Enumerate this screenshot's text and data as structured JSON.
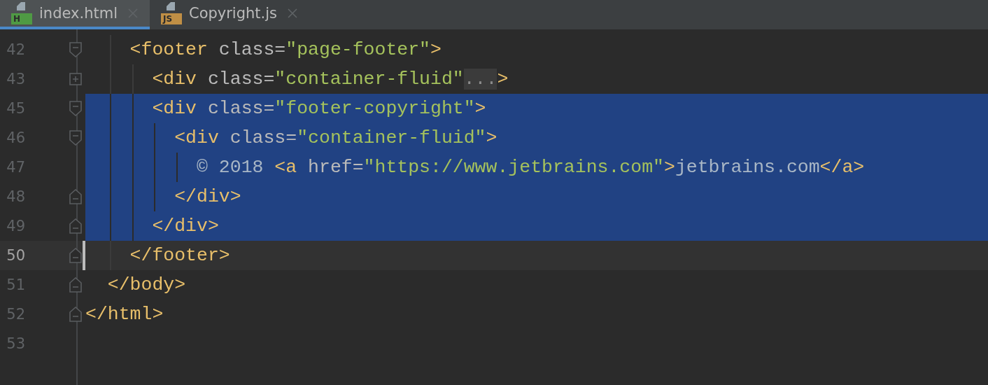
{
  "tabs": [
    {
      "label": "index.html",
      "badge": "H",
      "color": "#4f9a44",
      "selected": true
    },
    {
      "label": "Copyright.js",
      "badge": "JS",
      "color": "#c08f45",
      "selected": false
    }
  ],
  "lines": [
    {
      "number": "42",
      "kind": "opener",
      "selected": false,
      "current": false,
      "tokens": [
        {
          "kind": "tag",
          "text": "    <footer"
        },
        {
          "kind": "attr",
          "text": " class="
        },
        {
          "kind": "string",
          "text": "\"page-footer\""
        },
        {
          "kind": "tag",
          "text": ">"
        }
      ]
    },
    {
      "number": "43",
      "kind": "collapsed",
      "selected": false,
      "current": false,
      "tokens": [
        {
          "kind": "tag",
          "text": "      <div"
        },
        {
          "kind": "attr",
          "text": " class="
        },
        {
          "kind": "string",
          "text": "\"container-fluid\""
        },
        {
          "kind": "folded",
          "text": "..."
        },
        {
          "kind": "tag",
          "text": ">"
        }
      ]
    },
    {
      "number": "45",
      "kind": "opener",
      "selected": true,
      "current": false,
      "tokens": [
        {
          "kind": "tag",
          "text": "      <div"
        },
        {
          "kind": "attr",
          "text": " class="
        },
        {
          "kind": "string",
          "text": "\"footer-copyright\""
        },
        {
          "kind": "tag",
          "text": ">"
        }
      ]
    },
    {
      "number": "46",
      "kind": "opener",
      "selected": true,
      "current": false,
      "tokens": [
        {
          "kind": "tag",
          "text": "        <div"
        },
        {
          "kind": "attr",
          "text": " class="
        },
        {
          "kind": "string",
          "text": "\"container-fluid\""
        },
        {
          "kind": "tag",
          "text": ">"
        }
      ]
    },
    {
      "number": "47",
      "kind": "plain",
      "selected": true,
      "current": false,
      "tokens": [
        {
          "kind": "text",
          "text": "          © 2018 "
        },
        {
          "kind": "tag",
          "text": "<a"
        },
        {
          "kind": "attr",
          "text": " href="
        },
        {
          "kind": "string",
          "text": "\"https://www.jetbrains.com\""
        },
        {
          "kind": "tag",
          "text": ">"
        },
        {
          "kind": "text",
          "text": "jetbrains.com"
        },
        {
          "kind": "tag",
          "text": "</a>"
        }
      ]
    },
    {
      "number": "48",
      "kind": "closer",
      "selected": true,
      "current": false,
      "tokens": [
        {
          "kind": "tag",
          "text": "        </div>"
        }
      ]
    },
    {
      "number": "49",
      "kind": "closer",
      "selected": true,
      "current": false,
      "tokens": [
        {
          "kind": "tag",
          "text": "      </div>"
        }
      ]
    },
    {
      "number": "50",
      "kind": "closer",
      "selected": false,
      "current": true,
      "tokens": [
        {
          "kind": "tag",
          "text": "    </footer>"
        }
      ]
    },
    {
      "number": "51",
      "kind": "closer",
      "selected": false,
      "current": false,
      "tokens": [
        {
          "kind": "tag",
          "text": "  </body>"
        }
      ]
    },
    {
      "number": "52",
      "kind": "closer",
      "selected": false,
      "current": false,
      "tokens": [
        {
          "kind": "tag",
          "text": "</html>"
        }
      ]
    },
    {
      "number": "53",
      "kind": "plain",
      "selected": false,
      "current": false
    }
  ]
}
